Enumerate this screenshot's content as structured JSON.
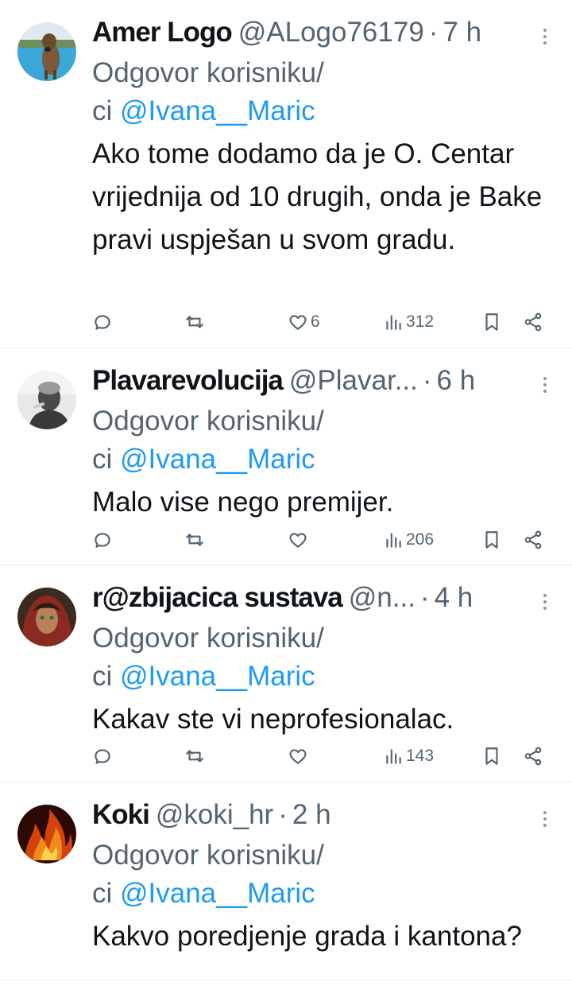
{
  "tweets": [
    {
      "name": "Amer Logo",
      "handle": "@ALogo76179",
      "time": "7 h",
      "reply_prefix": "Odgovor korisniku/",
      "reply_ci": "ci ",
      "reply_to": "@Ivana__Maric",
      "text": "Ako tome dodamo da je O. Centar vrijednija od 10 drugih, onda je Bake pravi uspješan u svom gradu.",
      "likes": "6",
      "views": "312"
    },
    {
      "name": "Plavarevolucija",
      "handle": "@Plavar...",
      "time": "6 h",
      "reply_prefix": "Odgovor korisniku/",
      "reply_ci": "ci ",
      "reply_to": "@Ivana__Maric",
      "text": "Malo vise nego premijer.",
      "likes": "",
      "views": "206"
    },
    {
      "name": "r@zbijacica sustava",
      "handle": "@n...",
      "time": "4 h",
      "reply_prefix": "Odgovor korisniku/",
      "reply_ci": "ci ",
      "reply_to": "@Ivana__Maric",
      "text": "Kakav ste vi neprofesionalac.",
      "likes": "",
      "views": "143"
    },
    {
      "name": "Koki",
      "handle": "@koki_hr",
      "time": "2 h",
      "reply_prefix": "Odgovor korisniku/",
      "reply_ci": "ci ",
      "reply_to": "@Ivana__Maric",
      "text": "Kakvo poredjenje grada i kantona?",
      "likes": "",
      "views": ""
    }
  ],
  "dot": "·",
  "icons": [
    "reply-icon",
    "retweet-icon",
    "like-icon",
    "views-icon",
    "bookmark-icon",
    "share-icon",
    "more-icon"
  ],
  "colors": {
    "link": "#1d9bf0",
    "muted": "#536471",
    "text": "#0f1419",
    "divider": "#e6e9ec"
  }
}
